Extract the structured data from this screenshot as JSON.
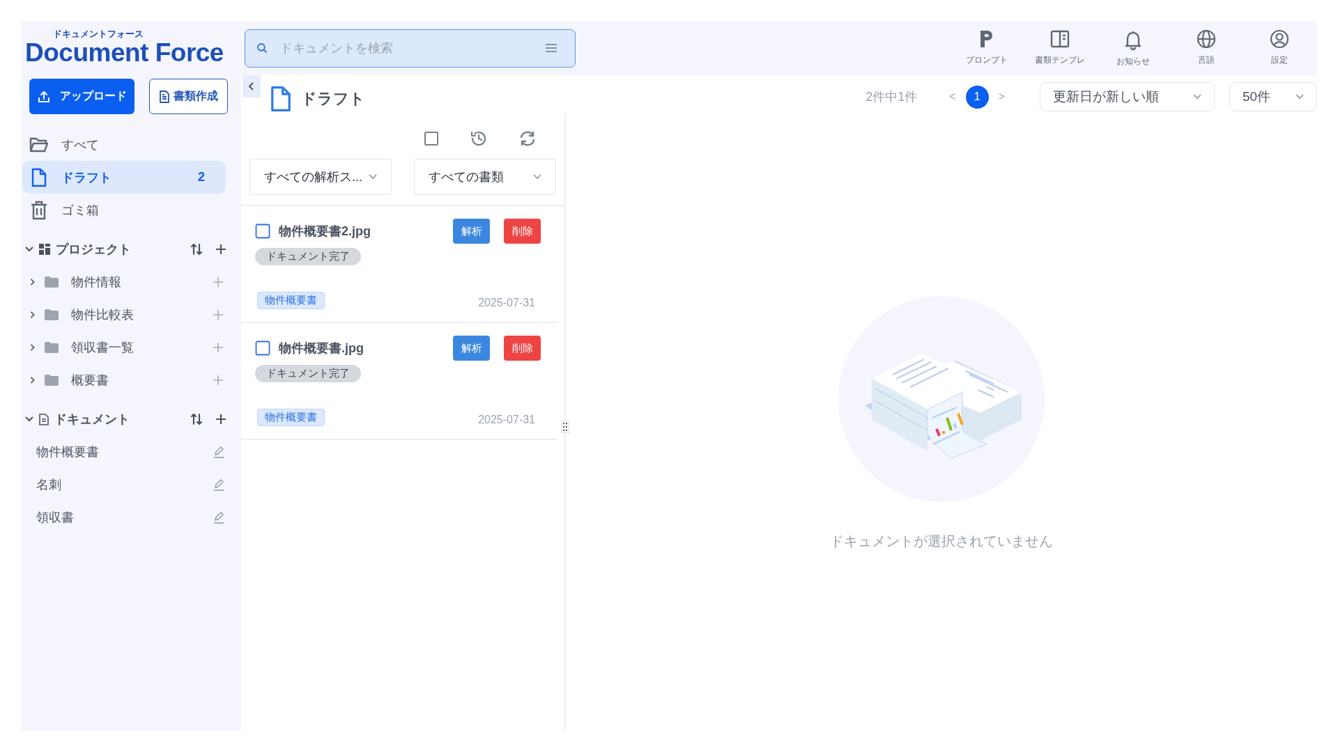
{
  "logo": {
    "subtitle": "ドキュメントフォース",
    "title": "Document Force"
  },
  "search": {
    "placeholder": "ドキュメントを検索"
  },
  "header_actions": [
    {
      "label": "プロンプト",
      "kind": "prompt"
    },
    {
      "label": "書類テンプレ",
      "kind": "template"
    },
    {
      "label": "お知らせ",
      "kind": "bell"
    },
    {
      "label": "言語",
      "kind": "globe"
    },
    {
      "label": "設定",
      "kind": "user"
    }
  ],
  "sidebar": {
    "buttons": [
      {
        "label": "アップロード",
        "kind": "primary"
      },
      {
        "label": "書類作成",
        "kind": "outline"
      }
    ],
    "nav": [
      {
        "label": "すべて",
        "kind": "folder",
        "selected": false
      },
      {
        "label": "ドラフト",
        "kind": "file",
        "selected": true,
        "count": "2"
      },
      {
        "label": "ゴミ箱",
        "kind": "trash",
        "selected": false
      }
    ],
    "sections": [
      {
        "title": "プロジェクト",
        "kind": "projects",
        "expanded": true,
        "items": [
          {
            "label": "物件情報",
            "expanded": false
          },
          {
            "label": "物件比較表",
            "expanded": false
          },
          {
            "label": "領収書一覧",
            "expanded": false
          },
          {
            "label": "概要書",
            "expanded": false
          }
        ]
      },
      {
        "title": "ドキュメント",
        "kind": "documents",
        "expanded": true,
        "items": [
          {
            "label": "物件概要書"
          },
          {
            "label": "名刺"
          },
          {
            "label": "領収書"
          }
        ]
      }
    ]
  },
  "page": {
    "title": "ドラフト"
  },
  "pagination": {
    "summary": "2件中1件",
    "prev": "<",
    "next": ">",
    "pages": [
      {
        "label": "1",
        "selected": true
      }
    ]
  },
  "sort": {
    "value": "更新日が新しい順"
  },
  "page_size": {
    "value": "50件"
  },
  "list_toolbar": {
    "select_all_checked": false
  },
  "filters": [
    {
      "value": "すべての解析ス..."
    },
    {
      "value": "すべての書類"
    }
  ],
  "documents": [
    {
      "name": "物件概要書2.jpg",
      "checked": false,
      "analyze": "解析",
      "delete": "削除",
      "status": "ドキュメント完了",
      "tag": "物件概要書",
      "date": "2025-07-31"
    },
    {
      "name": "物件概要書.jpg",
      "checked": false,
      "analyze": "解析",
      "delete": "削除",
      "status": "ドキュメント完了",
      "tag": "物件概要書",
      "date": "2025-07-31"
    }
  ],
  "detail": {
    "empty_message": "ドキュメントが選択されていません"
  }
}
